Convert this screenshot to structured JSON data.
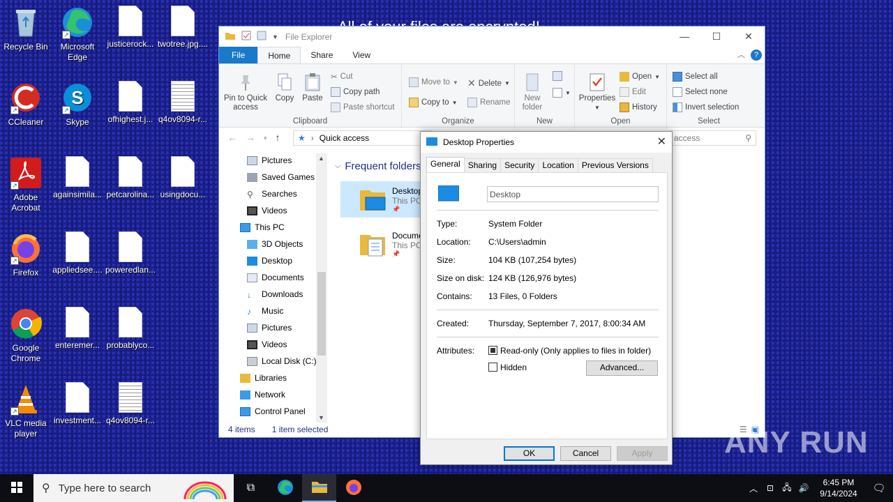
{
  "desktop": {
    "banner_text": "All of your files are encrypted!",
    "icons": [
      {
        "label": "Recycle Bin"
      },
      {
        "label": "Microsoft Edge"
      },
      {
        "label": "justicerock..."
      },
      {
        "label": "twotree.jpg...."
      },
      {
        "label": "CCleaner"
      },
      {
        "label": "Skype"
      },
      {
        "label": "ofhighest.j..."
      },
      {
        "label": "q4ov8094-r..."
      },
      {
        "label": "Adobe Acrobat"
      },
      {
        "label": "againsimila..."
      },
      {
        "label": "petcarolina..."
      },
      {
        "label": "usingdocu..."
      },
      {
        "label": "Firefox"
      },
      {
        "label": "appliedsee...."
      },
      {
        "label": "poweredlan..."
      },
      {
        "label": "Google Chrome"
      },
      {
        "label": "enteremer..."
      },
      {
        "label": "probablyco..."
      },
      {
        "label": "VLC media player"
      },
      {
        "label": "investment..."
      },
      {
        "label": "q4ov8094-r..."
      }
    ]
  },
  "explorer": {
    "title": "File Explorer",
    "tabs": [
      "File",
      "Home",
      "Share",
      "View"
    ],
    "clipboard": {
      "pin": "Pin to Quick access",
      "copy": "Copy",
      "paste": "Paste",
      "cut": "Cut",
      "copy_path": "Copy path",
      "paste_shortcut": "Paste shortcut",
      "group": "Clipboard"
    },
    "organize": {
      "move_to": "Move to",
      "copy_to": "Copy to",
      "delete": "Delete",
      "rename": "Rename",
      "group": "Organize"
    },
    "new": {
      "new_folder": "New folder",
      "group": "New"
    },
    "open": {
      "properties": "Properties",
      "open": "Open",
      "edit": "Edit",
      "history": "History",
      "group": "Open"
    },
    "select": {
      "select_all": "Select all",
      "select_none": "Select none",
      "invert": "Invert selection",
      "group": "Select"
    },
    "address": "Quick access",
    "search_placeholder": "access",
    "nav_items": [
      "Pictures",
      "Saved Games",
      "Searches",
      "Videos",
      "This PC",
      "3D Objects",
      "Desktop",
      "Documents",
      "Downloads",
      "Music",
      "Pictures",
      "Videos",
      "Local Disk (C:)",
      "Libraries",
      "Network",
      "Control Panel"
    ],
    "frequent_folders_label": "Frequent folders",
    "folders": [
      {
        "name": "Desktop",
        "location": "This PC"
      },
      {
        "name": "Docume",
        "location": "This PC"
      }
    ],
    "status": {
      "items": "4 items",
      "selected": "1 item selected"
    }
  },
  "dialog": {
    "title": "Desktop Properties",
    "tabs": [
      "General",
      "Sharing",
      "Security",
      "Location",
      "Previous Versions"
    ],
    "name_value": "Desktop",
    "fields": [
      {
        "label": "Type:",
        "value": "System Folder"
      },
      {
        "label": "Location:",
        "value": "C:\\Users\\admin"
      },
      {
        "label": "Size:",
        "value": "104 KB (107,254 bytes)"
      },
      {
        "label": "Size on disk:",
        "value": "124 KB (126,976 bytes)"
      },
      {
        "label": "Contains:",
        "value": "13 Files, 0 Folders"
      },
      {
        "label": "Created:",
        "value": "Thursday, September 7, 2017, 8:00:34 AM"
      }
    ],
    "attributes_label": "Attributes:",
    "readonly_label": "Read-only (Only applies to files in folder)",
    "hidden_label": "Hidden",
    "advanced_label": "Advanced...",
    "ok": "OK",
    "cancel": "Cancel",
    "apply": "Apply"
  },
  "taskbar": {
    "search_placeholder": "Type here to search",
    "time": "6:45 PM",
    "date": "9/14/2024"
  },
  "watermark": "ANY RUN"
}
